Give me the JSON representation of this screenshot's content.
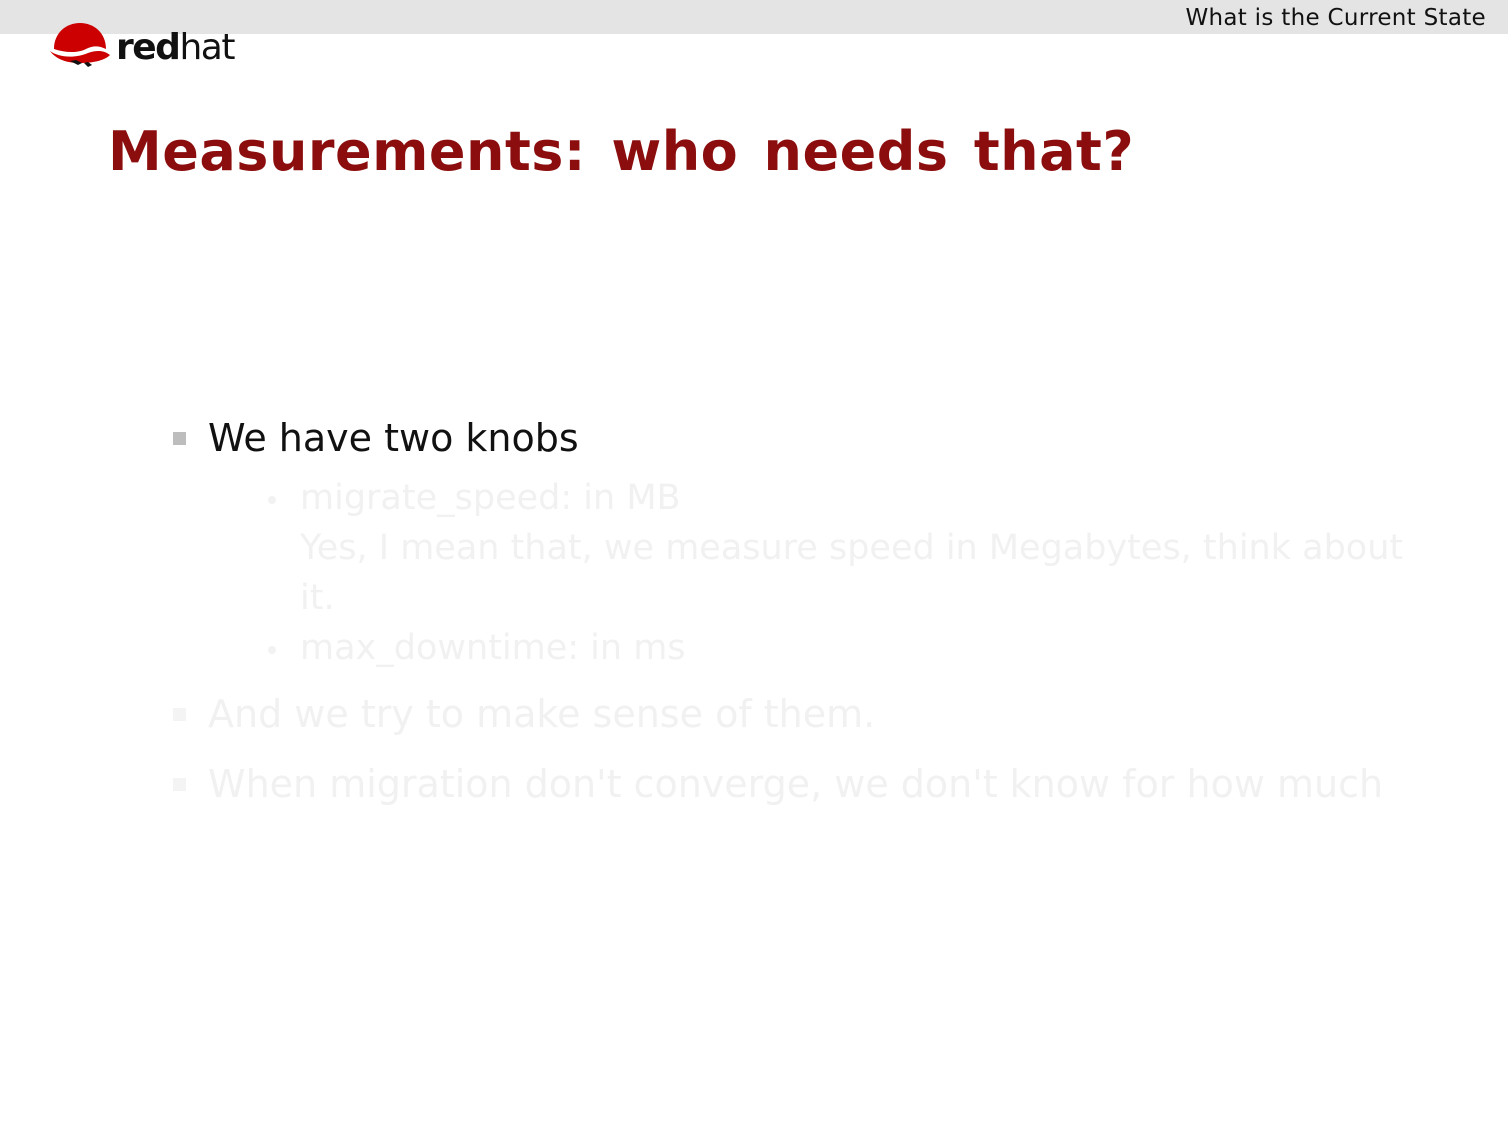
{
  "header": {
    "section_label": "What is the Current State"
  },
  "logo": {
    "brand_bold": "red",
    "brand_light": "hat",
    "accent_color": "#cc0000"
  },
  "slide": {
    "title": "Measurements: who needs that?",
    "bullets": [
      {
        "text": "We have two knobs",
        "visible": true,
        "sub_items": [
          {
            "line1": "migrate_speed: in MB",
            "line2": "Yes, I mean that, we measure speed in Megabytes, think about",
            "line3": "it."
          },
          {
            "line1": "max_downtime: in ms"
          }
        ]
      },
      {
        "text": "And we try to make sense of them.",
        "visible": false
      },
      {
        "text": "When migration don't converge, we don't know for how much",
        "visible": false
      }
    ]
  },
  "colors": {
    "title": "#8b0d0d",
    "header_bar": "#e4e4e4",
    "faded_text": "#f1f1f1"
  }
}
